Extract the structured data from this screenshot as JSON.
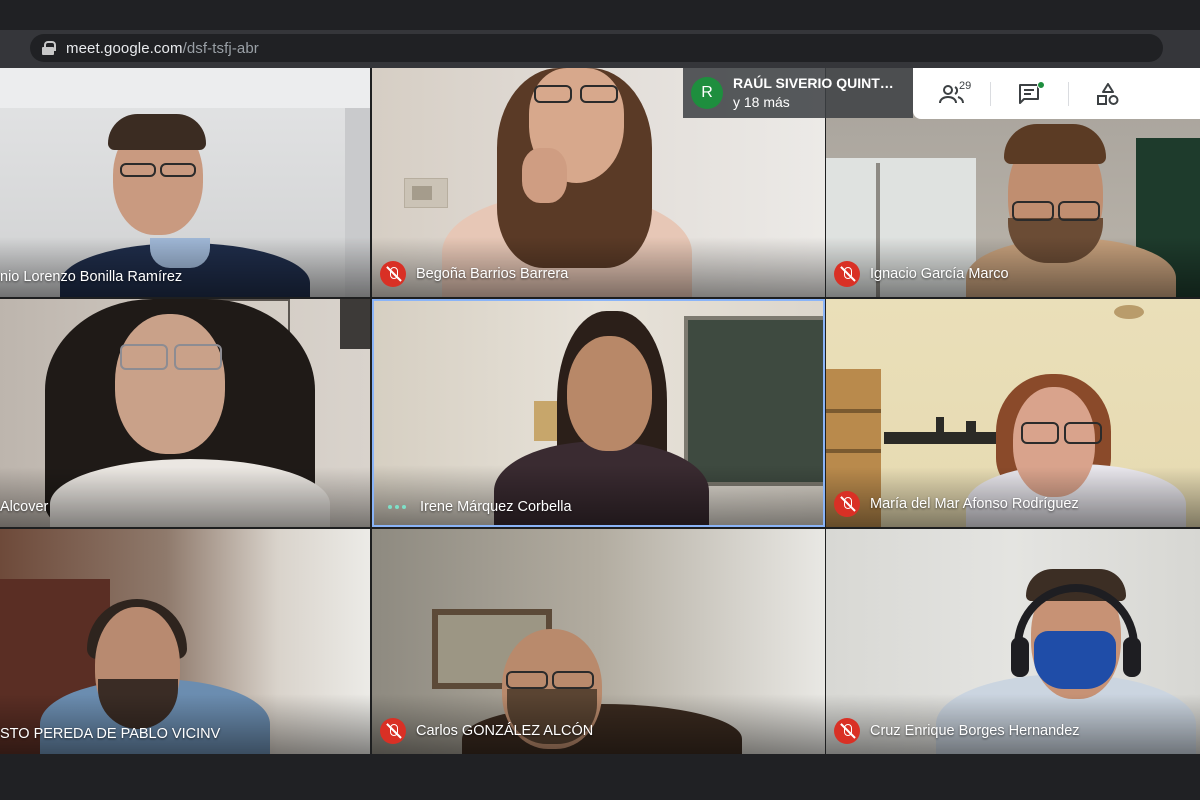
{
  "browser": {
    "url_host": "meet.google.com",
    "url_path": "/dsf-tsfj-abr"
  },
  "overlay": {
    "avatar_letter": "R",
    "name_line": "RAÚL SIVERIO QUINT…",
    "more_line": "y 18 más"
  },
  "toolbar": {
    "people_icon": "people-icon",
    "people_count": "29",
    "chat_icon": "chat-icon",
    "activities_icon": "activities-icon"
  },
  "participants": [
    {
      "name": "nio Lorenzo Bonilla Ramírez",
      "muted": false
    },
    {
      "name": "Begoña Barrios Barrera",
      "muted": true
    },
    {
      "name": "Ignacio García Marco",
      "muted": true
    },
    {
      "name": "Alcover",
      "muted": false
    },
    {
      "name": "Irene Márquez Corbella",
      "muted": false,
      "speaking": true
    },
    {
      "name": "María del Mar Afonso Rodríguez",
      "muted": true
    },
    {
      "name": "STO PEREDA DE PABLO VICINV",
      "muted": false
    },
    {
      "name": "Carlos GONZÁLEZ ALCÓN",
      "muted": true
    },
    {
      "name": "Cruz Enrique Borges Hernandez",
      "muted": true
    }
  ],
  "colors": {
    "mic_off": "#d93025",
    "avatar_green": "#1e8e3e",
    "speaking_dots": "#7ee0c8"
  }
}
